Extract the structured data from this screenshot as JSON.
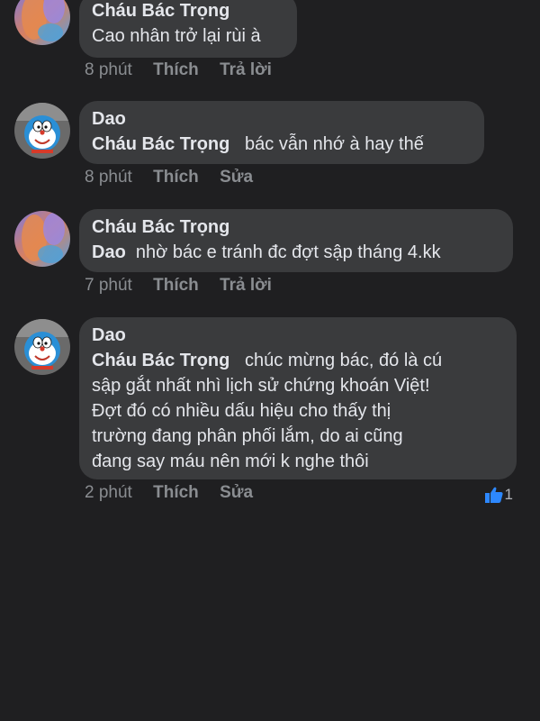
{
  "comments": [
    {
      "author": "Cháu Bác Trọng",
      "mention": "",
      "lines": [
        "Cao nhân trở lại rùi à"
      ],
      "time": "8 phút",
      "like_label": "Thích",
      "action2": "Trả lời"
    },
    {
      "author": "Dao",
      "mention": "Cháu Bác Trọng",
      "lines": [
        "bác vẫn nhớ à hay thế"
      ],
      "time": "8 phút",
      "like_label": "Thích",
      "action2": "Sửa"
    },
    {
      "author": "Cháu Bác Trọng",
      "mention": "Dao",
      "lines": [
        "nhờ bác e tránh đc đợt sập tháng 4.kk"
      ],
      "time": "7 phút",
      "like_label": "Thích",
      "action2": "Trả lời"
    },
    {
      "author": "Dao",
      "mention": "Cháu Bác Trọng",
      "lines": [
        "chúc mừng bác, đó là cú",
        "sập gắt nhất nhì lịch sử chứng khoán Việt!",
        "Đợt đó có nhiều dấu hiệu cho thấy thị",
        "trường đang phân phối lắm, do ai cũng",
        "đang say máu nên mới k nghe thôi"
      ],
      "time": "2 phút",
      "like_label": "Thích",
      "action2": "Sửa",
      "reaction_count": "1"
    }
  ],
  "colors": {
    "background": "#1f1f21",
    "bubble": "#3a3b3d",
    "text": "#e4e6eb",
    "meta": "#8a8d91",
    "like_blue": "#2d88ff"
  },
  "icons": {
    "avatar_user1": "colorful-abstract-avatar",
    "avatar_user2": "doraemon-avatar",
    "reaction": "thumbs-up-icon"
  }
}
